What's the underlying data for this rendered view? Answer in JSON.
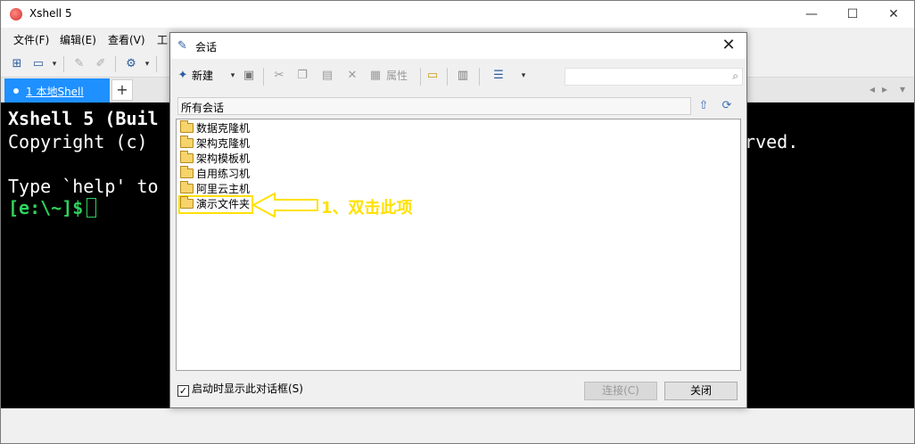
{
  "window": {
    "title": "Xshell 5",
    "controls": {
      "minimize": "—",
      "maximize": "☐",
      "close": "✕"
    }
  },
  "menu": {
    "items": [
      "文件(F)",
      "编辑(E)",
      "查看(V)",
      "工"
    ]
  },
  "tabs": {
    "active_label": "1 本地Shell",
    "add_label": "+",
    "nav_prev": "◂",
    "nav_next": "▸",
    "nav_menu": "▾"
  },
  "terminal": {
    "lines": [
      "Xshell 5 (Buil",
      "Copyright (c)",
      "",
      "Type `help' to",
      "[e:\\~]$"
    ],
    "right_fragment": "erved."
  },
  "dialog": {
    "title": "会话",
    "close_label": "✕",
    "toolbar": {
      "new_label": "新建",
      "properties_label": "属性"
    },
    "search_placeholder": "",
    "path": "所有会话",
    "folders": [
      "数据克隆机",
      "架构克隆机",
      "架构模板机",
      "自用练习机",
      "阿里云主机",
      "演示文件夹"
    ],
    "selected_index": 5,
    "startup_checkbox_label": "启动时显示此对话框(S)",
    "startup_checked": true,
    "connect_label": "连接(C)",
    "close_button_label": "关闭"
  },
  "annotation": {
    "text": "1、双击此项",
    "color": "#ffe100"
  },
  "colors": {
    "tab_active": "#1e90ff",
    "terminal_bg": "#000000",
    "prompt_green": "#2ed15d",
    "highlight_yellow": "#ffe100"
  }
}
